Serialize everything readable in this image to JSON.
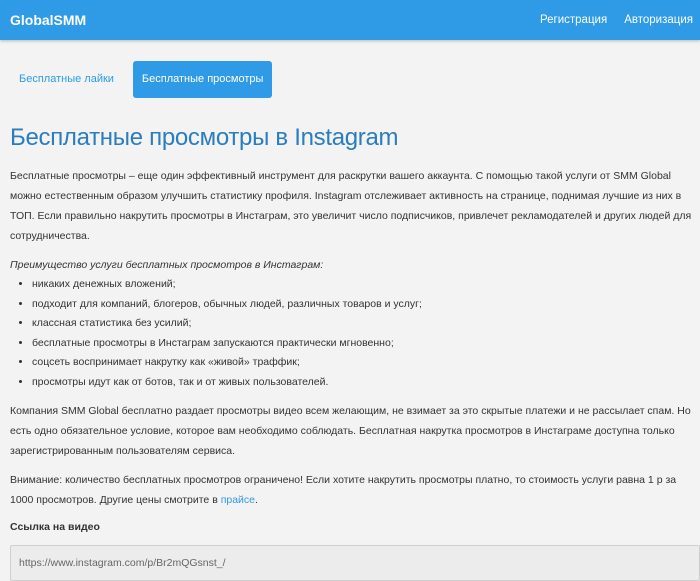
{
  "navbar": {
    "brand": "GlobalSMM",
    "links": [
      "Регистрация",
      "Авторизация"
    ]
  },
  "tabs": [
    {
      "label": "Бесплатные лайки",
      "active": false
    },
    {
      "label": "Бесплатные просмотры",
      "active": true
    }
  ],
  "page_title": "Бесплатные просмотры в Instagram",
  "intro": "Бесплатные просмотры – еще один эффективный инструмент для раскрутки вашего аккаунта. С помощью такой услуги от SMM Global можно естественным образом улучшить статистику профиля. Instagram отслеживает активность на странице, поднимая лучшие из них в ТОП. Если правильно накрутить просмотры в Инстаграм, это увеличит число подписчиков, привлечет рекламодателей и других людей для сотрудничества.",
  "advantages": {
    "title": "Преимущество услуги бесплатных просмотров в Инстаграм:",
    "items": [
      "никаких денежных вложений;",
      "подходит для компаний, блогеров, обычных людей, различных товаров и услуг;",
      "классная статистика без усилий;",
      "бесплатные просмотры в Инстаграм запускаются практически мгновенно;",
      "соцсеть воспринимает накрутку как «живой» траффик;",
      "просмотры идут как от ботов, так и от живых пользователей."
    ]
  },
  "company_text": "Компания SMM Global бесплатно раздает просмотры видео всем желающим, не взимает за это скрытые платежи и не рассылает спам. Но есть одно обязательное условие, которое вам необходимо соблюдать. Бесплатная накрутка просмотров в Инстаграме доступна только зарегистрированным пользователям сервиса.",
  "notice": {
    "text": "Внимание: количество бесплатных просмотров ограничено! Если хотите накрутить просмотры платно, то стоимость услуги равна 1 р за 1000 просмотров. Другие цены смотрите в ",
    "link": "прайсе",
    "suffix": "."
  },
  "video_field": {
    "label": "Ссылка на видео",
    "value": "https://www.instagram.com/p/Br2mQGsnst_/"
  },
  "colors": {
    "primary": "#2f9ae5",
    "title": "#2a7dbf",
    "background": "#f3f3f3"
  }
}
